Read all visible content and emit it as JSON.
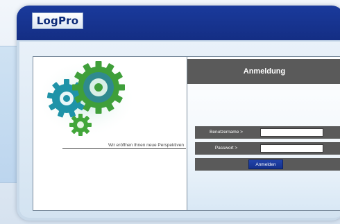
{
  "header": {
    "logo_text": "LogPro"
  },
  "left_pane": {
    "tagline": "Wir eröffnen Ihnen neue Perspektiven",
    "image_icon": "gears-icon"
  },
  "login": {
    "title": "Anmeldung",
    "username_label": "Benutzername >",
    "username_value": "",
    "password_label": "Passwort >",
    "password_value": "",
    "submit_label": "Anmelden"
  },
  "colors": {
    "header_blue": "#142e84",
    "logo_text": "#0c2a78",
    "form_bar": "#5a5a5a",
    "button_blue": "#1a3a9c",
    "gear_teal": "#1a9bb0",
    "gear_green": "#3aa030"
  }
}
